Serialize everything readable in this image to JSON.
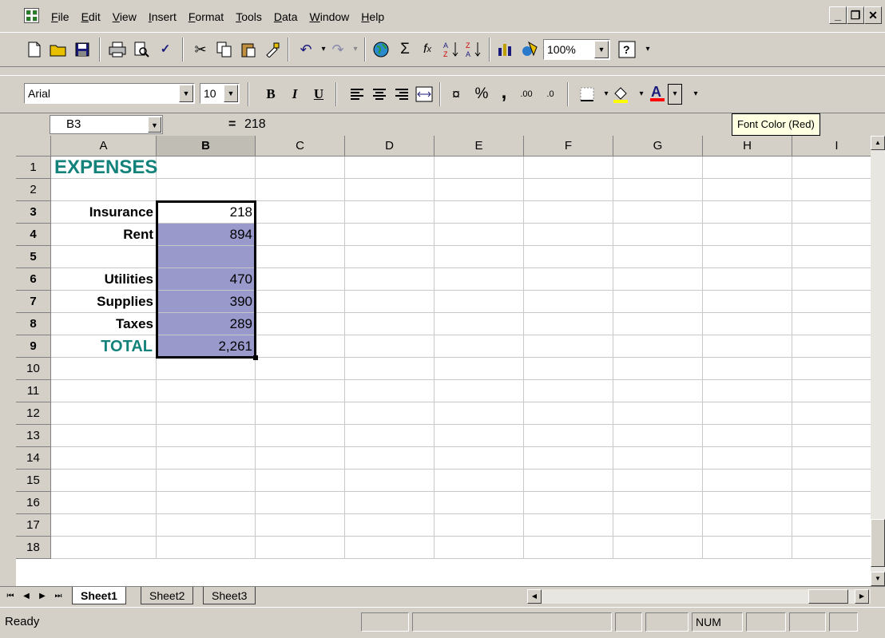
{
  "menubar": {
    "items": [
      "File",
      "Edit",
      "View",
      "Insert",
      "Format",
      "Tools",
      "Data",
      "Window",
      "Help"
    ],
    "window_controls": [
      "_",
      "´",
      "✕"
    ]
  },
  "standard_toolbar": {
    "zoom": "100%"
  },
  "format_toolbar": {
    "font": "Arial",
    "size": "10",
    "bold": "B",
    "italic": "I",
    "underline": "U",
    "currency": "¤",
    "percent": "%",
    "comma": ",",
    "inc_decimal": ".00",
    "dec_decimal": ".0"
  },
  "formula_bar": {
    "name_box": "B3",
    "equals": "=",
    "content": "218"
  },
  "tooltip": "Font Color (Red)",
  "columns": [
    "A",
    "B",
    "C",
    "D",
    "E",
    "F",
    "G",
    "H",
    "I"
  ],
  "rows": [
    "1",
    "2",
    "3",
    "4",
    "5",
    "6",
    "7",
    "8",
    "9",
    "10",
    "11",
    "12",
    "13",
    "14",
    "15",
    "16",
    "17",
    "18"
  ],
  "sheet": {
    "title": "EXPENSES",
    "entries": [
      {
        "row": 3,
        "label": "Insurance",
        "value": "218"
      },
      {
        "row": 4,
        "label": "Rent",
        "value": "894"
      },
      {
        "row": 5,
        "label": "",
        "value": ""
      },
      {
        "row": 6,
        "label": "Utilities",
        "value": "470"
      },
      {
        "row": 7,
        "label": "Supplies",
        "value": "390"
      },
      {
        "row": 8,
        "label": "Taxes",
        "value": "289"
      }
    ],
    "total_label": "TOTAL",
    "total_value": "2,261"
  },
  "sheet_tabs": [
    "Sheet1",
    "Sheet2",
    "Sheet3"
  ],
  "status": {
    "ready": "Ready",
    "num": "NUM"
  },
  "colors": {
    "accent_teal": "#12827a",
    "selection_fill": "#9999cc",
    "tooltip_bg": "#ffffe1"
  }
}
